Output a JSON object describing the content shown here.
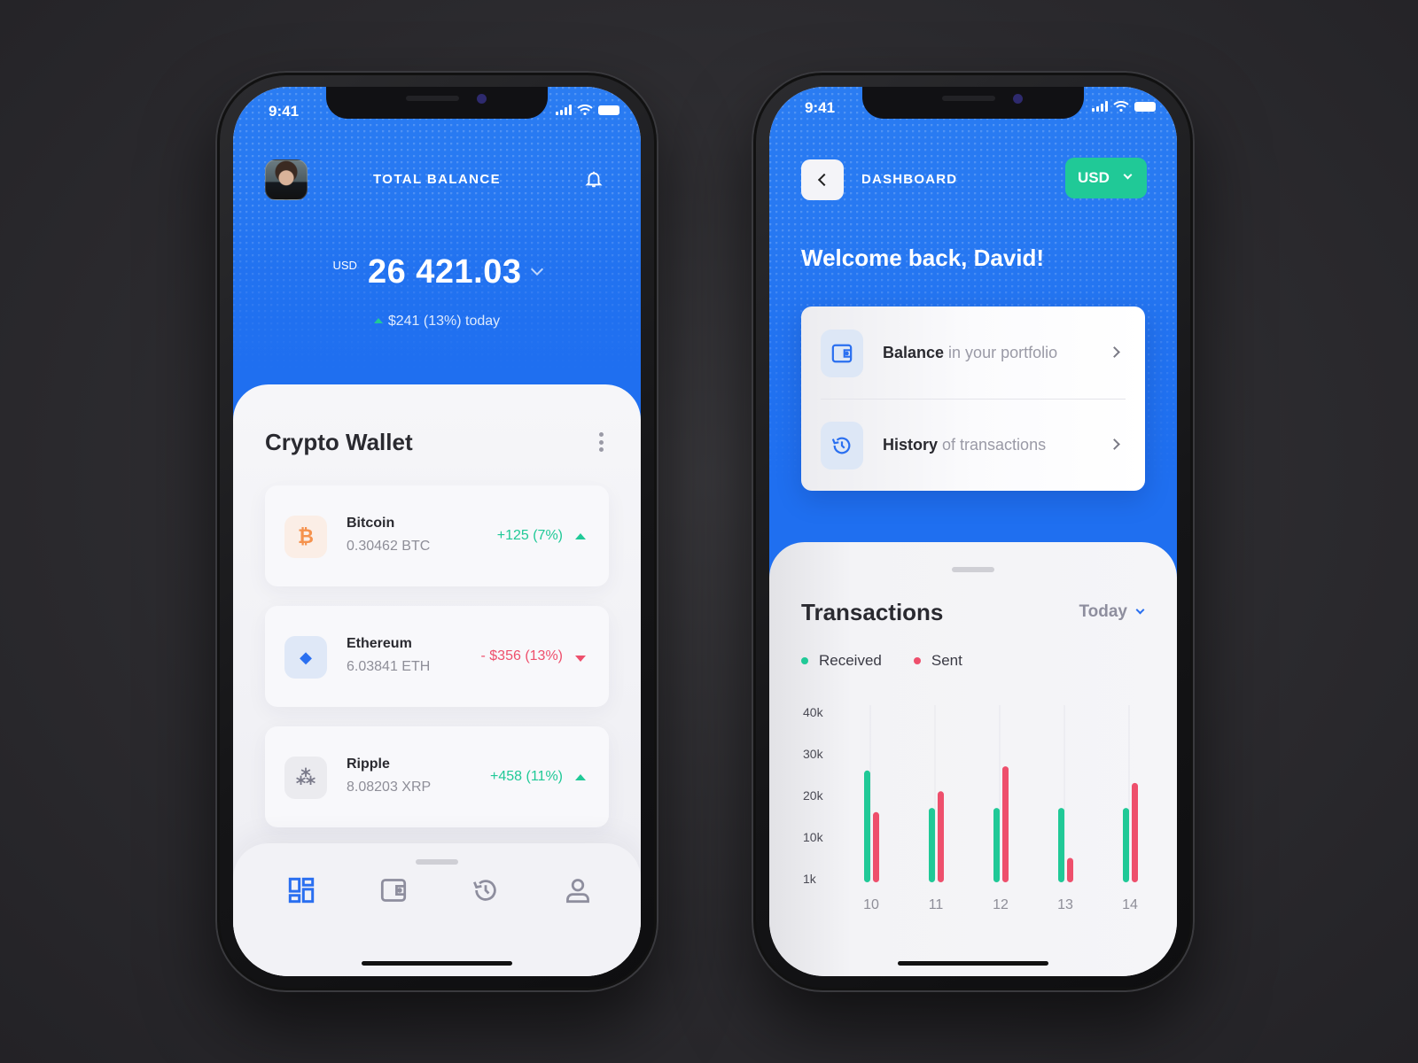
{
  "colors": {
    "primary_blue": "#1f6ff0",
    "green": "#20c997",
    "red": "#ee4f6c",
    "bitcoin_orange": "#f5924d",
    "ethereum_blue": "#2a6ff0",
    "ripple_gray": "#7a7a8a"
  },
  "left_phone": {
    "status_bar": {
      "time": "9:41",
      "icons": [
        "signal-icon",
        "wifi-icon",
        "battery-icon"
      ]
    },
    "header": {
      "title": "TOTAL BALANCE",
      "avatar": "avatar",
      "notification_icon": "bell-icon"
    },
    "balance": {
      "currency": "USD",
      "amount": "26 421.03",
      "change_text": "$241 (13%) today",
      "change_direction": "up"
    },
    "wallet": {
      "title": "Crypto Wallet",
      "menu_icon": "more-vertical-icon",
      "coins": [
        {
          "name": "Bitcoin",
          "amount": "0.30462 BTC",
          "change": "+125 (7%)",
          "direction": "up",
          "icon": "bitcoin-icon",
          "symbol": "₿"
        },
        {
          "name": "Ethereum",
          "amount": "6.03841 ETH",
          "change": "- $356 (13%)",
          "direction": "down",
          "icon": "ethereum-icon",
          "symbol": "◆"
        },
        {
          "name": "Ripple",
          "amount": "8.08203 XRP",
          "change": "+458 (11%)",
          "direction": "up",
          "icon": "ripple-icon",
          "symbol": "⁂"
        }
      ]
    },
    "tab_bar": {
      "active_index": 0,
      "tabs": [
        {
          "name": "dashboard",
          "icon": "dashboard-icon"
        },
        {
          "name": "wallet",
          "icon": "wallet-icon"
        },
        {
          "name": "history",
          "icon": "history-icon"
        },
        {
          "name": "profile",
          "icon": "user-icon"
        }
      ]
    }
  },
  "right_phone": {
    "status_bar": {
      "time": "9:41"
    },
    "header": {
      "back_icon": "chevron-left-icon",
      "title": "DASHBOARD",
      "currency_selector": "USD"
    },
    "welcome": "Welcome back, David!",
    "menu": [
      {
        "bold": "Balance",
        "light": " in your portfolio",
        "icon": "wallet-icon"
      },
      {
        "bold": "History",
        "light": " of transactions",
        "icon": "history-icon"
      }
    ],
    "transactions": {
      "title": "Transactions",
      "filter": "Today",
      "legend": [
        {
          "label": "Received",
          "color": "#20c997"
        },
        {
          "label": "Sent",
          "color": "#ee4f6c"
        }
      ]
    }
  },
  "chart_data": {
    "type": "bar",
    "title": "Transactions",
    "categories": [
      "10",
      "11",
      "12",
      "13",
      "14"
    ],
    "y_tick_labels": [
      "40k",
      "30k",
      "20k",
      "10k",
      "1k"
    ],
    "y_ticks": [
      40000,
      30000,
      20000,
      10000,
      0
    ],
    "ylim": [
      0,
      40000
    ],
    "series": [
      {
        "name": "Received",
        "color": "#20c997",
        "values": [
          26000,
          17000,
          17000,
          17000,
          17000
        ]
      },
      {
        "name": "Sent",
        "color": "#ee4f6c",
        "values": [
          16000,
          21000,
          27000,
          5000,
          23000
        ]
      }
    ],
    "legend": "top-left",
    "grid": "vertical"
  }
}
